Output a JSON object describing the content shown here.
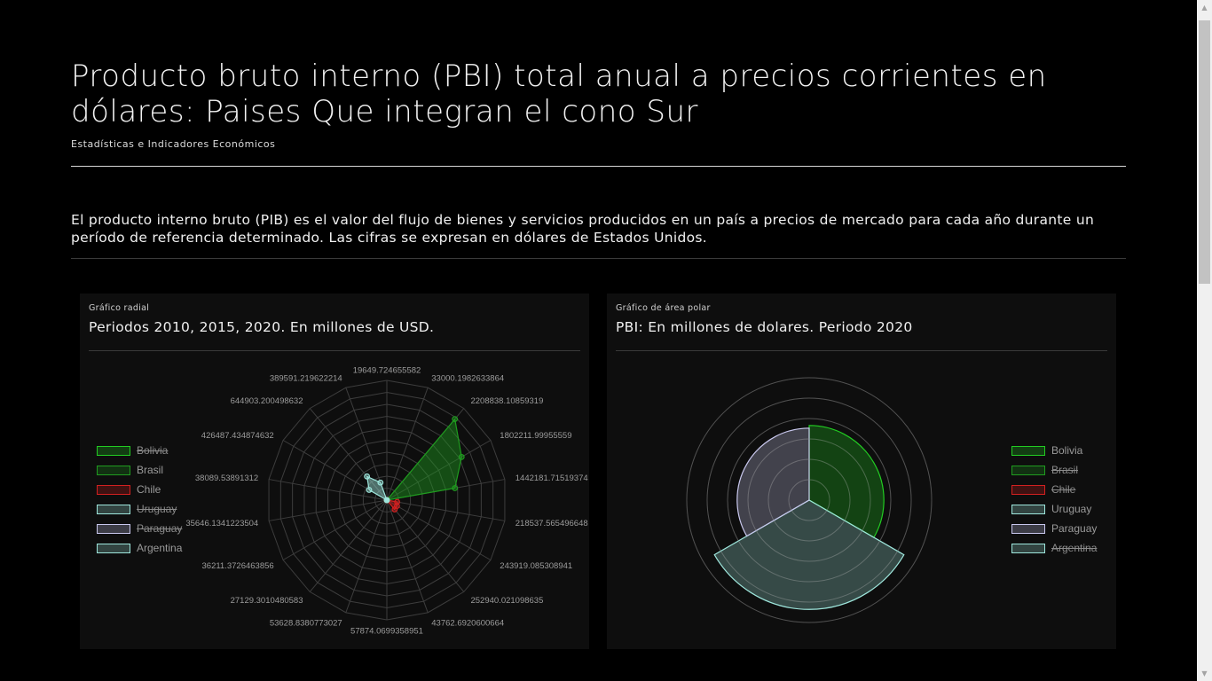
{
  "header": {
    "title": "Producto bruto interno (PBI) total anual a precios corrientes en dólares: Paises Que integran el cono Sur",
    "subtitle": "Estadísticas e Indicadores Económicos"
  },
  "intro": "El producto interno bruto (PIB) es el valor del flujo de bienes y servicios producidos en un país a precios de mercado para cada año durante un período de referencia determinado. Las cifras se expresan en dólares de Estados Unidos.",
  "colors": {
    "Bolivia": "#22cc22",
    "Brasil": "#1f9c1f",
    "Chile": "#d42020",
    "Uruguay": "#9ee6dc",
    "Paraguay": "#c9c8ee",
    "Argentina": "#9ee6dc"
  },
  "chart_data": [
    {
      "type": "radar",
      "chart_label": "Gráfico radial",
      "title": "Periodos 2010, 2015, 2020. En millones de USD.",
      "categories": [
        "19649.724655582",
        "33000.1982633864",
        "2208838.10859319",
        "1802211.99955559",
        "1442181.71519374",
        "218537.565496648",
        "243919.085308941",
        "252940.021098635",
        "43762.6920600664",
        "57874.0699358951",
        "53628.8380773027",
        "27129.3010480583",
        "36211.3726463856",
        "35646.1341223504",
        "38089.53891312",
        "426487.434874632",
        "644903.200498632",
        "389591.219622214"
      ],
      "series": [
        {
          "name": "Bolivia",
          "hidden": true,
          "values": []
        },
        {
          "name": "Brasil",
          "hidden": false,
          "values": [
            0,
            0,
            2208838.10859319,
            1802211.99955559,
            1442181.71519374,
            0,
            0,
            0,
            0,
            0,
            0,
            0,
            0,
            0,
            0,
            0,
            0,
            0
          ]
        },
        {
          "name": "Chile",
          "hidden": false,
          "values": [
            0,
            0,
            0,
            0,
            0,
            218537.565496648,
            243919.085308941,
            252940.021098635,
            0,
            0,
            0,
            0,
            0,
            0,
            0,
            0,
            0,
            0
          ]
        },
        {
          "name": "Uruguay",
          "hidden": true,
          "values": []
        },
        {
          "name": "Paraguay",
          "hidden": true,
          "values": []
        },
        {
          "name": "Argentina",
          "hidden": false,
          "values": [
            0,
            0,
            0,
            0,
            0,
            0,
            0,
            0,
            0,
            0,
            0,
            0,
            0,
            0,
            0,
            426487.434874632,
            644903.200498632,
            389591.219622214
          ]
        }
      ]
    },
    {
      "type": "polarArea",
      "chart_label": "Gráfico de área polar",
      "title": "PBI: En millones de dolares. Periodo 2020",
      "categories": [
        "Bolivia",
        "Brasil",
        "Chile",
        "Uruguay",
        "Paraguay",
        "Argentina"
      ],
      "values": [
        36600,
        null,
        null,
        53600,
        35300,
        null
      ],
      "hidden": [
        false,
        true,
        true,
        false,
        false,
        true
      ],
      "rlim": [
        0,
        60000
      ]
    }
  ]
}
